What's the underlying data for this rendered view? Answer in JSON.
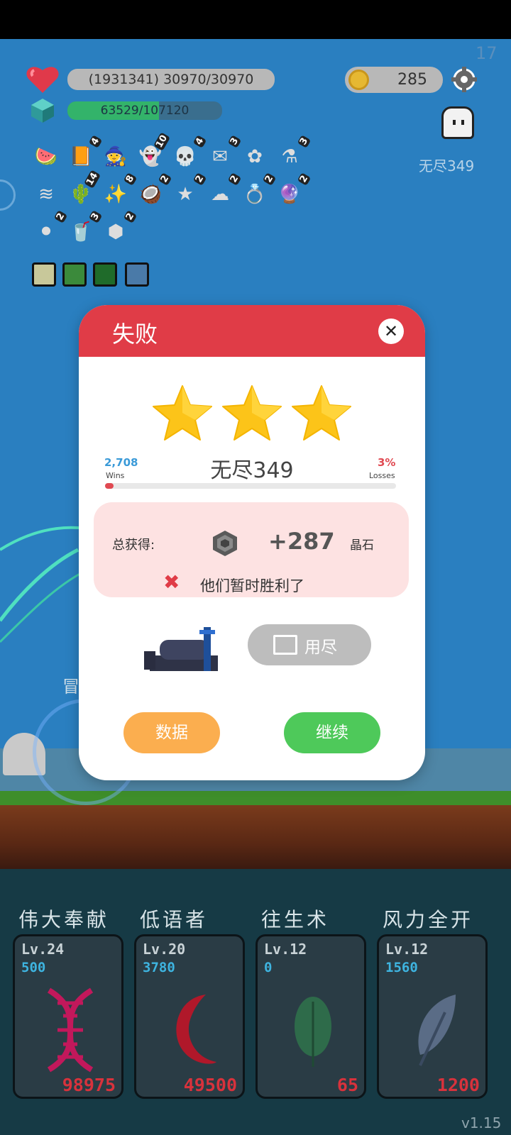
{
  "hud": {
    "hp_text": "(1931341) 30970/30970",
    "hp_fraction": 1.0,
    "xp_text": "63529/107120",
    "xp_fraction": 0.593,
    "coins": "285",
    "corner_number": "17",
    "mode_label": "无尽349"
  },
  "inventory": [
    {
      "icon": "watermelon-icon",
      "count": ""
    },
    {
      "icon": "book-icon",
      "count": "4"
    },
    {
      "icon": "wizard-hat-icon",
      "count": ""
    },
    {
      "icon": "ghost-icon",
      "count": "10"
    },
    {
      "icon": "skull-icon",
      "count": "4"
    },
    {
      "icon": "envelope-icon",
      "count": "3"
    },
    {
      "icon": "gear-flower-icon",
      "count": ""
    },
    {
      "icon": "potion-icon",
      "count": "3"
    },
    {
      "icon": "wings-icon",
      "count": ""
    },
    {
      "icon": "cactus-icon",
      "count": "14"
    },
    {
      "icon": "wand-icon",
      "count": "8"
    },
    {
      "icon": "coconut-icon",
      "count": "2"
    },
    {
      "icon": "star-box-icon",
      "count": "2"
    },
    {
      "icon": "dark-cloud-icon",
      "count": "2"
    },
    {
      "icon": "ring-icon",
      "count": "2"
    },
    {
      "icon": "crystal-ball-icon",
      "count": "2"
    },
    {
      "icon": "cauldron-icon",
      "count": "2"
    },
    {
      "icon": "drink-icon",
      "count": "3"
    },
    {
      "icon": "gem-icon",
      "count": "2"
    }
  ],
  "modal": {
    "title": "失败",
    "stars": 3,
    "wins_value": "2,708",
    "wins_label": "Wins",
    "losses_value": "3%",
    "losses_label": "Losses",
    "stage": "无尽349",
    "loss_fraction": 0.03,
    "reward_label": "总获得:",
    "reward_amount": "+287",
    "reward_unit": "晶石",
    "fail_message": "他们暂时胜利了",
    "video_button": "用尽",
    "stats_button": "数据",
    "continue_button": "继续"
  },
  "behind_text": "冒",
  "skills": [
    {
      "name": "伟大奉献",
      "level": "Lv.24",
      "value": "500",
      "cost": "98975",
      "icon": "dna-icon",
      "color": "#c2185b"
    },
    {
      "name": "低语者",
      "level": "Lv.20",
      "value": "3780",
      "cost": "49500",
      "icon": "crescent-moon-icon",
      "color": "#b0182a"
    },
    {
      "name": "往生术",
      "level": "Lv.12",
      "value": "0",
      "cost": "65",
      "icon": "leaf-icon",
      "color": "#2e6b4a"
    },
    {
      "name": "风力全开",
      "level": "Lv.12",
      "value": "1560",
      "cost": "1200",
      "icon": "feather-icon",
      "color": "#5a6c86"
    }
  ],
  "version": "v1.15"
}
